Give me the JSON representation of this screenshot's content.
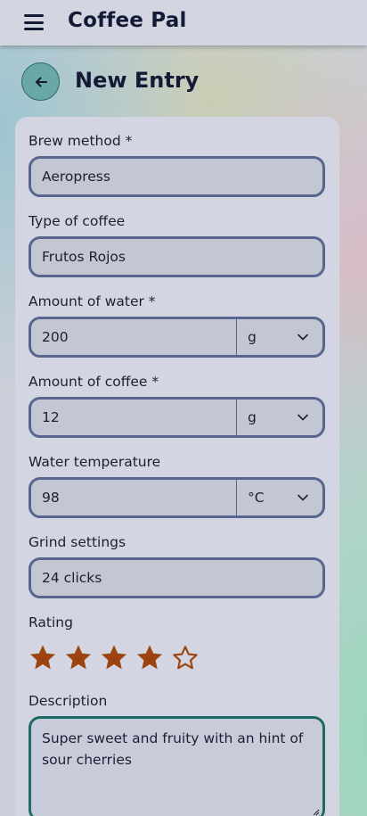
{
  "app": {
    "title": "Coffee Pal"
  },
  "page": {
    "title": "New Entry"
  },
  "form": {
    "brew_method": {
      "label": "Brew method *",
      "value": "Aeropress"
    },
    "coffee_type": {
      "label": "Type of coffee",
      "value": "Frutos Rojos"
    },
    "water_amount": {
      "label": "Amount of water *",
      "value": "200",
      "unit": "g"
    },
    "coffee_amount": {
      "label": "Amount of coffee *",
      "value": "12",
      "unit": "g"
    },
    "water_temp": {
      "label": "Water temperature",
      "value": "98",
      "unit": "°C"
    },
    "grind": {
      "label": "Grind settings",
      "value": "24 clicks"
    },
    "rating": {
      "label": "Rating",
      "value": 4,
      "max": 5
    },
    "description": {
      "label": "Description",
      "value": "Super sweet and fruity with an hint of sour cherries"
    }
  },
  "colors": {
    "star": "#9b4410",
    "accent_teal": "#1e6b66",
    "field_border": "#58668f",
    "title": "#131a36"
  },
  "icons": {
    "menu": "hamburger-icon",
    "back": "arrow-left-icon",
    "dropdown": "chevron-down-icon",
    "rating_filled": "star-filled-icon",
    "rating_empty": "star-outline-icon",
    "resize": "resize-handle-icon"
  }
}
